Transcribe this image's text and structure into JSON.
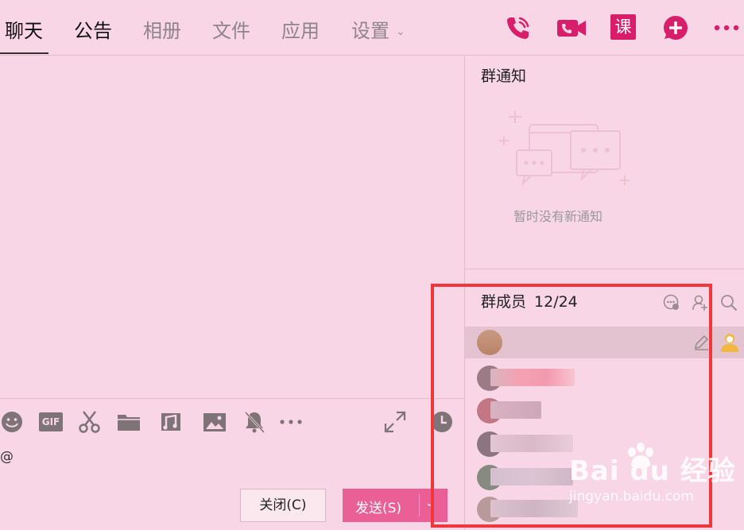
{
  "tabs": [
    {
      "label": "聊天",
      "active": true
    },
    {
      "label": "公告",
      "active": false
    },
    {
      "label": "相册",
      "active": false
    },
    {
      "label": "文件",
      "active": false
    },
    {
      "label": "应用",
      "active": false
    },
    {
      "label": "设置",
      "active": false
    }
  ],
  "top_icons": [
    "phone-icon",
    "video-icon",
    "course-icon",
    "add-icon",
    "more-icon"
  ],
  "course_glyph": "课",
  "notice": {
    "title": "群通知",
    "empty_text": "暂时没有新通知"
  },
  "members": {
    "title": "群成员",
    "count": "12/24"
  },
  "toolbar_icons": [
    "emoji-icon",
    "gif-icon",
    "scissors-icon",
    "folder-icon",
    "music-icon",
    "image-icon",
    "bell-off-icon",
    "more-icon",
    "expand-icon",
    "history-icon"
  ],
  "gif_label": "GIF",
  "input": {
    "text": "@"
  },
  "buttons": {
    "close": "关闭(C)",
    "send": "发送(S)"
  },
  "watermark": {
    "brand": "Bai du 经验",
    "url": "jingyan.baidu.com"
  },
  "colors": {
    "background": "#f9d6e5",
    "accent": "#d81e6b",
    "send_button": "#ea5f95",
    "annotation": "#f0373b"
  }
}
